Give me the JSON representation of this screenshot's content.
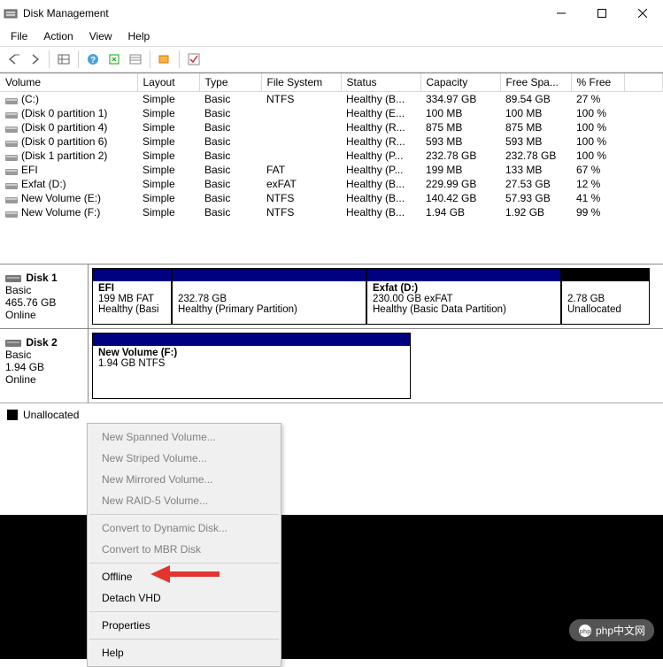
{
  "window": {
    "title": "Disk Management"
  },
  "menu": {
    "file": "File",
    "action": "Action",
    "view": "View",
    "help": "Help"
  },
  "columns": {
    "volume": "Volume",
    "layout": "Layout",
    "type": "Type",
    "fs": "File System",
    "status": "Status",
    "capacity": "Capacity",
    "free": "Free Spa...",
    "pct": "% Free"
  },
  "volumes": [
    {
      "name": "(C:)",
      "layout": "Simple",
      "type": "Basic",
      "fs": "NTFS",
      "status": "Healthy (B...",
      "cap": "334.97 GB",
      "free": "89.54 GB",
      "pct": "27 %"
    },
    {
      "name": "(Disk 0 partition 1)",
      "layout": "Simple",
      "type": "Basic",
      "fs": "",
      "status": "Healthy (E...",
      "cap": "100 MB",
      "free": "100 MB",
      "pct": "100 %"
    },
    {
      "name": "(Disk 0 partition 4)",
      "layout": "Simple",
      "type": "Basic",
      "fs": "",
      "status": "Healthy (R...",
      "cap": "875 MB",
      "free": "875 MB",
      "pct": "100 %"
    },
    {
      "name": "(Disk 0 partition 6)",
      "layout": "Simple",
      "type": "Basic",
      "fs": "",
      "status": "Healthy (R...",
      "cap": "593 MB",
      "free": "593 MB",
      "pct": "100 %"
    },
    {
      "name": "(Disk 1 partition 2)",
      "layout": "Simple",
      "type": "Basic",
      "fs": "",
      "status": "Healthy (P...",
      "cap": "232.78 GB",
      "free": "232.78 GB",
      "pct": "100 %"
    },
    {
      "name": "EFI",
      "layout": "Simple",
      "type": "Basic",
      "fs": "FAT",
      "status": "Healthy (P...",
      "cap": "199 MB",
      "free": "133 MB",
      "pct": "67 %"
    },
    {
      "name": "Exfat (D:)",
      "layout": "Simple",
      "type": "Basic",
      "fs": "exFAT",
      "status": "Healthy (B...",
      "cap": "229.99 GB",
      "free": "27.53 GB",
      "pct": "12 %"
    },
    {
      "name": "New Volume (E:)",
      "layout": "Simple",
      "type": "Basic",
      "fs": "NTFS",
      "status": "Healthy (B...",
      "cap": "140.42 GB",
      "free": "57.93 GB",
      "pct": "41 %"
    },
    {
      "name": "New Volume (F:)",
      "layout": "Simple",
      "type": "Basic",
      "fs": "NTFS",
      "status": "Healthy (B...",
      "cap": "1.94 GB",
      "free": "1.92 GB",
      "pct": "99 %"
    }
  ],
  "disks": {
    "d1": {
      "name": "Disk 1",
      "type": "Basic",
      "size": "465.76 GB",
      "state": "Online"
    },
    "d2": {
      "name": "Disk 2",
      "type": "Basic",
      "size": "1.94 GB",
      "state": "Online"
    }
  },
  "parts1": {
    "p0": {
      "name": "EFI",
      "l2": "199 MB FAT",
      "l3": "Healthy (Basi"
    },
    "p1": {
      "name": "",
      "l2": "232.78 GB",
      "l3": "Healthy (Primary Partition)"
    },
    "p2": {
      "name": "Exfat  (D:)",
      "l2": "230.00 GB exFAT",
      "l3": "Healthy (Basic Data Partition)"
    },
    "p3": {
      "name": "",
      "l2": "2.78 GB",
      "l3": "Unallocated"
    }
  },
  "parts2": {
    "p0": {
      "name": "New Volume  (F:)",
      "l2": "1.94 GB NTFS"
    }
  },
  "legend": {
    "unalloc": "Unallocated"
  },
  "ctx": {
    "spanned": "New Spanned Volume...",
    "striped": "New Striped Volume...",
    "mirrored": "New Mirrored Volume...",
    "raid": "New RAID-5 Volume...",
    "dyn": "Convert to Dynamic Disk...",
    "mbr": "Convert to MBR Disk",
    "offline": "Offline",
    "detach": "Detach VHD",
    "props": "Properties",
    "help": "Help"
  },
  "watermark": "php中文网"
}
